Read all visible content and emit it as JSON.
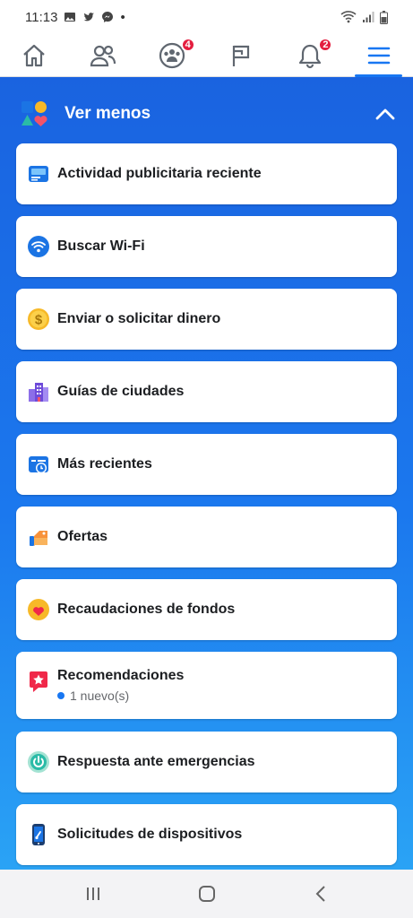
{
  "status_bar": {
    "time": "11:13",
    "dot": "•"
  },
  "nav": {
    "tabs": [
      {
        "name": "home-icon"
      },
      {
        "name": "friends-icon"
      },
      {
        "name": "groups-icon",
        "badge": "4"
      },
      {
        "name": "pages-flag-icon"
      },
      {
        "name": "notifications-bell-icon",
        "badge": "2"
      },
      {
        "name": "menu-icon",
        "active": true
      }
    ]
  },
  "section": {
    "title": "Ver menos"
  },
  "items": [
    {
      "label": "Actividad publicitaria reciente",
      "icon": "ad-activity-icon"
    },
    {
      "label": "Buscar Wi-Fi",
      "icon": "wifi-icon"
    },
    {
      "label": "Enviar o solicitar dinero",
      "icon": "money-icon"
    },
    {
      "label": "Guías de ciudades",
      "icon": "city-guide-icon"
    },
    {
      "label": "Más recientes",
      "icon": "recent-icon"
    },
    {
      "label": "Ofertas",
      "icon": "offers-icon"
    },
    {
      "label": "Recaudaciones de fondos",
      "icon": "fundraiser-heart-icon"
    },
    {
      "label": "Recomendaciones",
      "icon": "recommendations-star-icon",
      "sub": "1 nuevo(s)"
    },
    {
      "label": "Respuesta ante emergencias",
      "icon": "emergency-response-icon"
    },
    {
      "label": "Solicitudes de dispositivos",
      "icon": "device-requests-icon"
    }
  ],
  "colors": {
    "accent": "#1877f2",
    "badge": "#e41e3f",
    "text": "#1c1e21"
  }
}
